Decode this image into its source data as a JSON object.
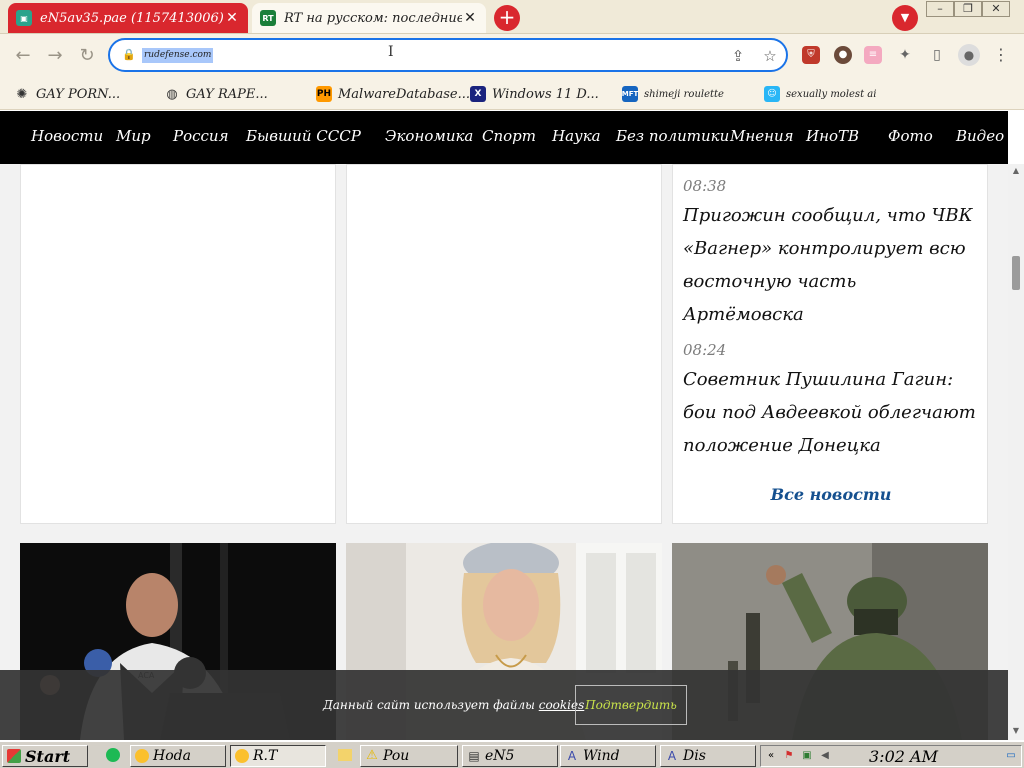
{
  "browser": {
    "tabs": [
      {
        "title": "eN5av35.pae (1157413006)",
        "active": false
      },
      {
        "title": "RT на русском: последние новости",
        "active": true
      }
    ],
    "url": "rudefense.com",
    "window_controls": [
      "–",
      "❐",
      "✕"
    ]
  },
  "bookmarks": [
    {
      "label": "GAY PORN..."
    },
    {
      "label": "GAY RAPE..."
    },
    {
      "label": "MalwareDatabase..."
    },
    {
      "label": "Windows 11 D..."
    },
    {
      "label": "shimeji roulette"
    },
    {
      "label": "sexually molest ai"
    }
  ],
  "site_nav": {
    "items": [
      "Новости",
      "Мир",
      "Россия",
      "Бывший СССР",
      "Экономика",
      "Спорт",
      "Наука",
      "Без политики",
      "Мнения",
      "ИноТВ",
      "Фото",
      "Видео"
    ]
  },
  "news_feed": {
    "items": [
      {
        "time": "08:38",
        "text": "Пригожин сообщил, что ЧВК «Вагнер» контролирует всю восточную часть Артёмовска"
      },
      {
        "time": "08:24",
        "text": "Советник Пушилина Гагин: бои под Авдеевкой облегчают положение Донецка"
      }
    ],
    "all_news_label": "Все новости"
  },
  "cookie_banner": {
    "text_before": "Данный сайт использует файлы",
    "link_label": "cookies",
    "confirm_label": "Подтвердить"
  },
  "taskbar": {
    "start_label": "Start",
    "buttons": [
      {
        "label": "Hoda"
      },
      {
        "label": "R.T"
      },
      {
        "label": "Pou"
      },
      {
        "label": "eN5"
      },
      {
        "label": "Wind"
      },
      {
        "label": "Dis"
      }
    ],
    "clock": "3:02 AM"
  },
  "colors": {
    "tab_accent": "#d9272e",
    "site_nav_bg": "#000000",
    "all_news_link": "#15508f",
    "cookie_button_text": "#c9e34a",
    "omnibox_border": "#1a73e8"
  }
}
